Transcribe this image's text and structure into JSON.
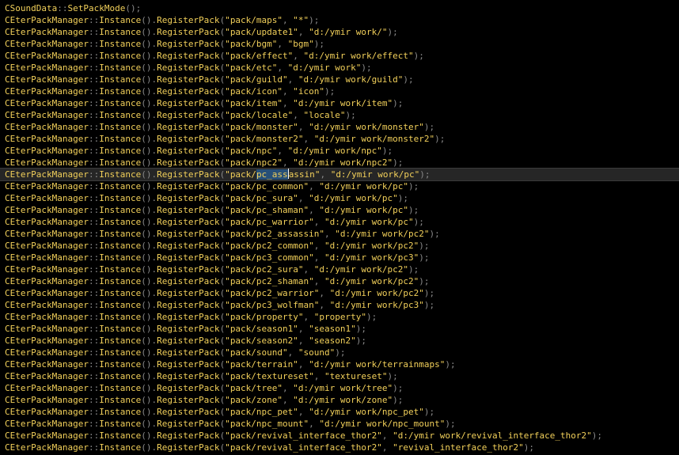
{
  "editor": {
    "current_line_index": 14,
    "selection": {
      "line_index": 14,
      "text": "pc_assassin",
      "selected_part": "pc_ass"
    },
    "lines": [
      {
        "cls": "CSoundData",
        "method": "SetPackMode",
        "call_suffix": "();"
      },
      {
        "pack": "pack/maps",
        "path": "*"
      },
      {
        "pack": "pack/update1",
        "path": "d:/ymir work/"
      },
      {
        "pack": "pack/bgm",
        "path": "bgm"
      },
      {
        "pack": "pack/effect",
        "path": "d:/ymir work/effect"
      },
      {
        "pack": "pack/etc",
        "path": "d:/ymir work"
      },
      {
        "pack": "pack/guild",
        "path": "d:/ymir work/guild"
      },
      {
        "pack": "pack/icon",
        "path": "icon"
      },
      {
        "pack": "pack/item",
        "path": "d:/ymir work/item"
      },
      {
        "pack": "pack/locale",
        "path": "locale"
      },
      {
        "pack": "pack/monster",
        "path": "d:/ymir work/monster"
      },
      {
        "pack": "pack/monster2",
        "path": "d:/ymir work/monster2"
      },
      {
        "pack": "pack/npc",
        "path": "d:/ymir work/npc"
      },
      {
        "pack": "pack/npc2",
        "path": "d:/ymir work/npc2"
      },
      {
        "pack": "pack/pc_assassin",
        "path": "d:/ymir work/pc"
      },
      {
        "pack": "pack/pc_common",
        "path": "d:/ymir work/pc"
      },
      {
        "pack": "pack/pc_sura",
        "path": "d:/ymir work/pc"
      },
      {
        "pack": "pack/pc_shaman",
        "path": "d:/ymir work/pc"
      },
      {
        "pack": "pack/pc_warrior",
        "path": "d:/ymir work/pc"
      },
      {
        "pack": "pack/pc2_assassin",
        "path": "d:/ymir work/pc2"
      },
      {
        "pack": "pack/pc2_common",
        "path": "d:/ymir work/pc2"
      },
      {
        "pack": "pack/pc3_common",
        "path": "d:/ymir work/pc3"
      },
      {
        "pack": "pack/pc2_sura",
        "path": "d:/ymir work/pc2"
      },
      {
        "pack": "pack/pc2_shaman",
        "path": "d:/ymir work/pc2"
      },
      {
        "pack": "pack/pc2_warrior",
        "path": "d:/ymir work/pc2"
      },
      {
        "pack": "pack/pc3_wolfman",
        "path": "d:/ymir work/pc3"
      },
      {
        "pack": "pack/property",
        "path": "property"
      },
      {
        "pack": "pack/season1",
        "path": "season1"
      },
      {
        "pack": "pack/season2",
        "path": "season2"
      },
      {
        "pack": "pack/sound",
        "path": "sound"
      },
      {
        "pack": "pack/terrain",
        "path": "d:/ymir work/terrainmaps"
      },
      {
        "pack": "pack/textureset",
        "path": "textureset"
      },
      {
        "pack": "pack/tree",
        "path": "d:/ymir work/tree"
      },
      {
        "pack": "pack/zone",
        "path": "d:/ymir work/zone"
      },
      {
        "pack": "pack/npc_pet",
        "path": "d:/ymir work/npc_pet"
      },
      {
        "pack": "pack/npc_mount",
        "path": "d:/ymir work/npc_mount"
      },
      {
        "pack": "pack/revival_interface_thor2",
        "path": "d:/ymir work/revival_interface_thor2"
      },
      {
        "pack": "pack/revival_interface_thor2",
        "path": "revival_interface_thor2"
      }
    ],
    "register_class": "CEterPackManager",
    "instance_method": "Instance",
    "register_method": "RegisterPack"
  },
  "colors": {
    "background": "#000000",
    "identifier": "#f2d05a",
    "operator": "#8a8a8a",
    "current_line": "#262626",
    "selection": "#264f78"
  }
}
